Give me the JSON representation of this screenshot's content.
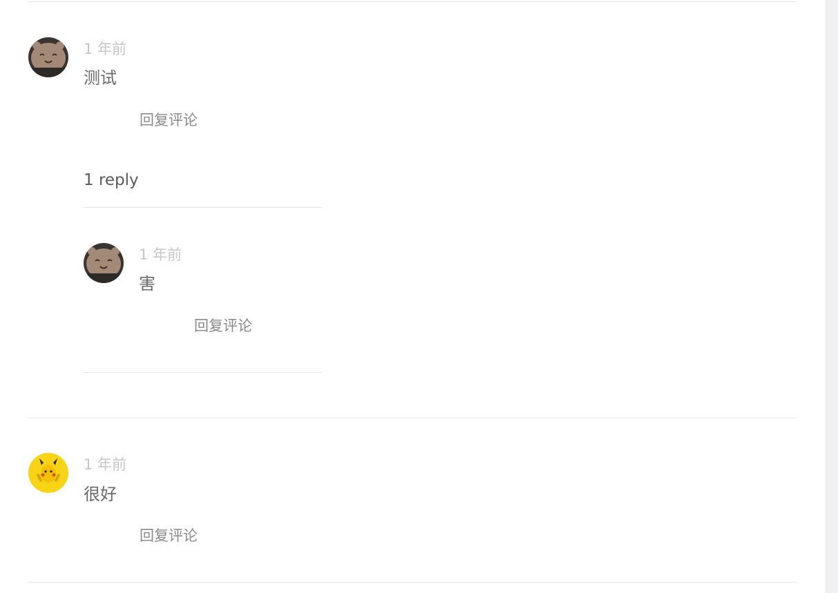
{
  "comments": [
    {
      "avatar": "bear-avatar",
      "time": "1 年前",
      "content": "测试",
      "reply_label": "回复评论",
      "reply_count": "1 reply",
      "replies": [
        {
          "avatar": "bear-avatar",
          "time": "1 年前",
          "content": "害",
          "reply_label": "回复评论"
        }
      ]
    },
    {
      "avatar": "pikachu-avatar",
      "time": "1 年前",
      "content": "很好",
      "reply_label": "回复评论"
    }
  ]
}
